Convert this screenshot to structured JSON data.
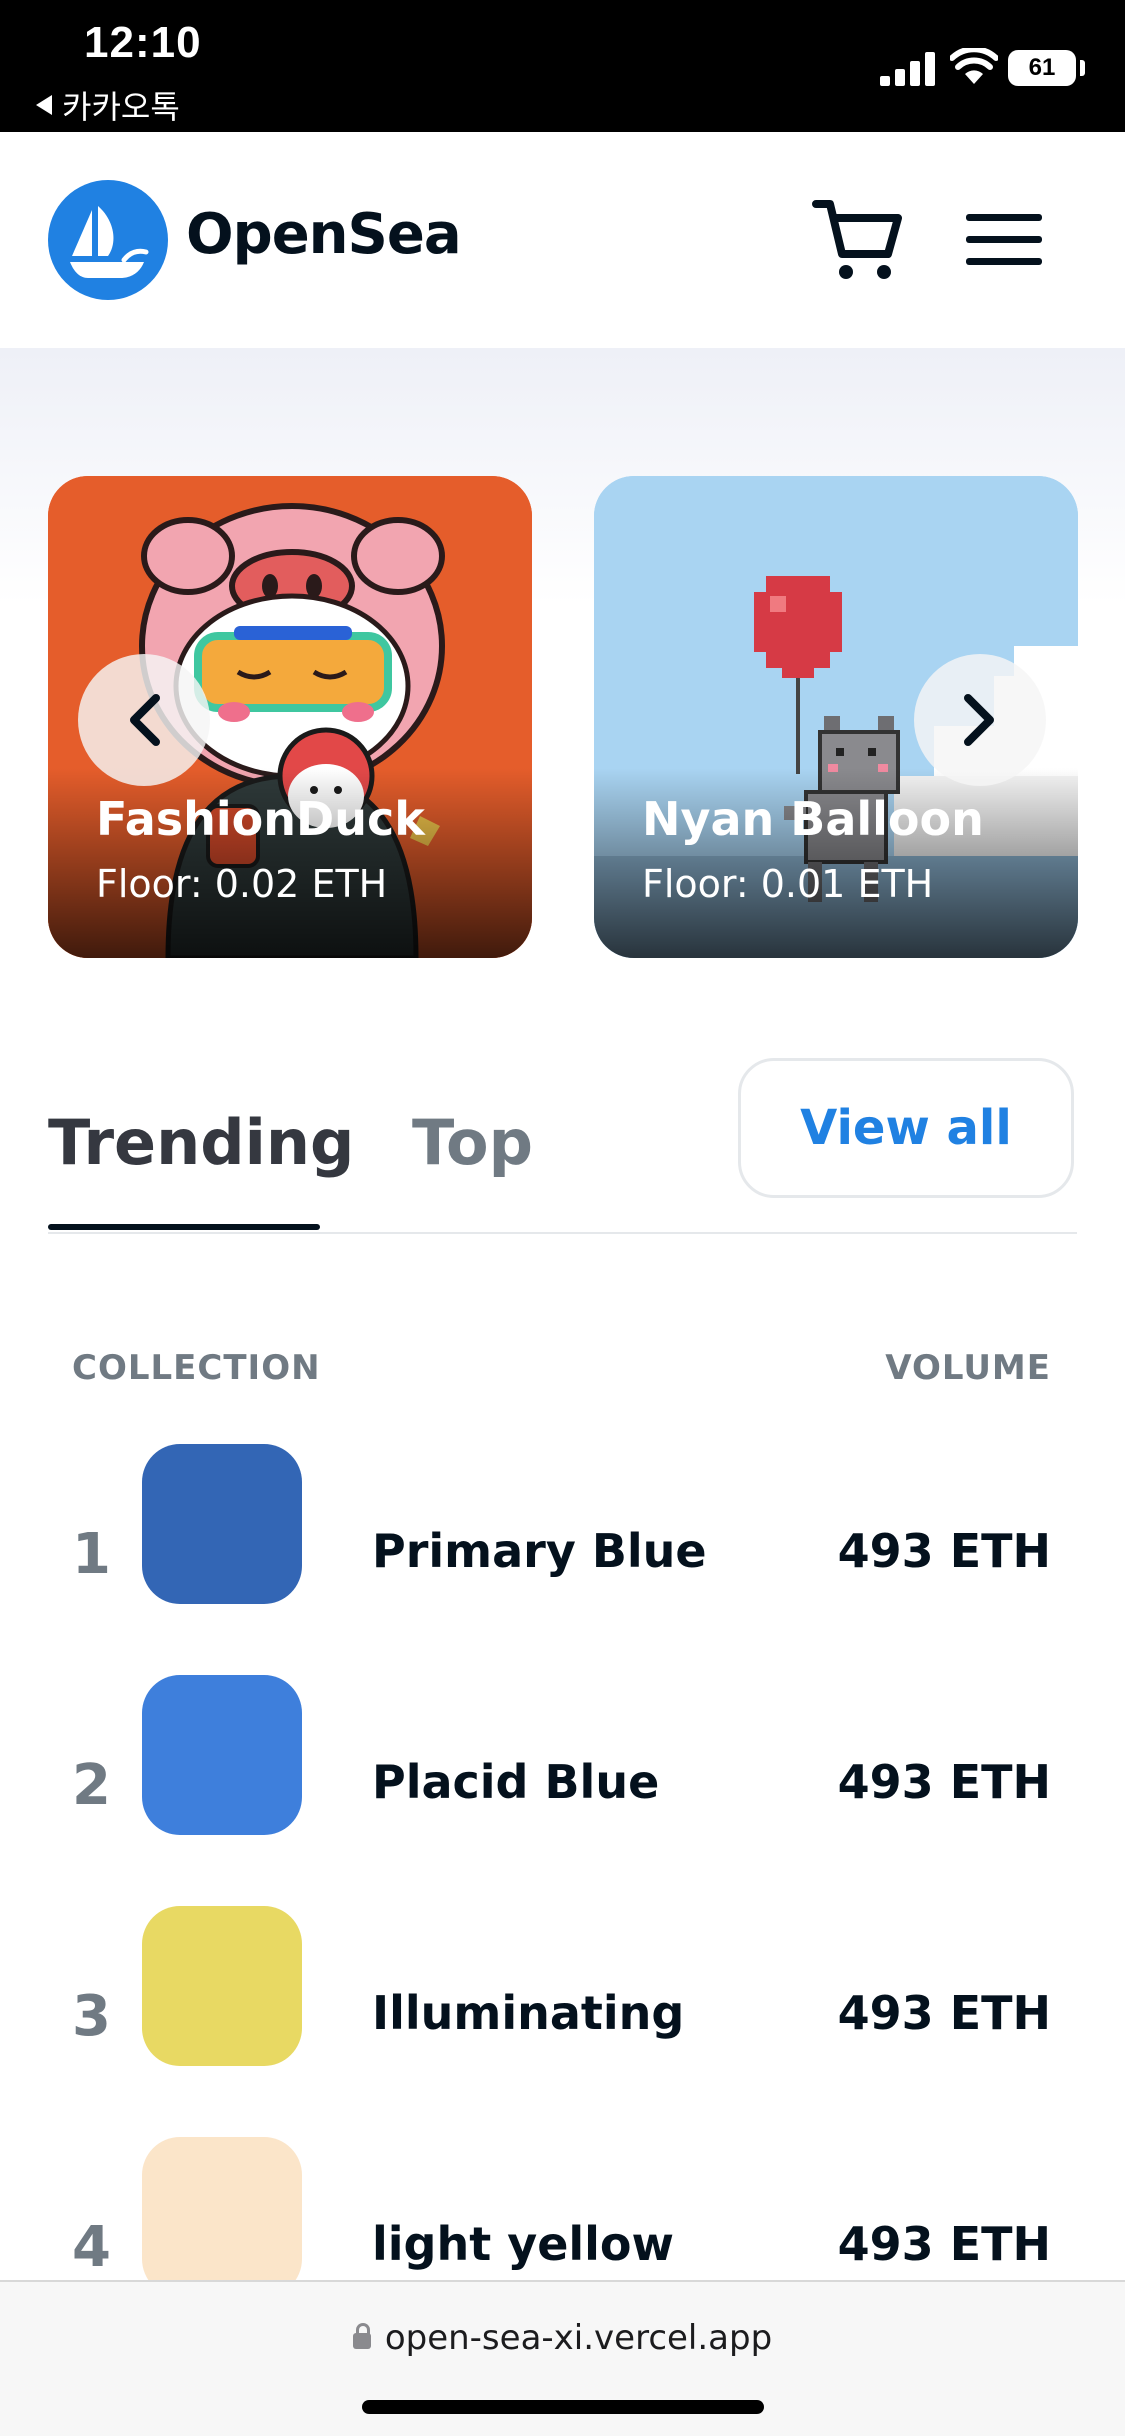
{
  "status_bar": {
    "time": "12:10",
    "back_app": "카카오톡",
    "battery": "61"
  },
  "header": {
    "brand": "OpenSea",
    "icons": [
      "logo-icon",
      "cart-icon",
      "menu-icon"
    ]
  },
  "carousel": {
    "cards": [
      {
        "title": "FashionDuck",
        "floor": "Floor: 0.02 ETH",
        "bg": "#e55d2b"
      },
      {
        "title": "Nyan Balloon",
        "floor": "Floor: 0.01 ETH",
        "bg": "#a9d4f2"
      }
    ]
  },
  "tabs": {
    "items": [
      {
        "label": "Trending",
        "active": true
      },
      {
        "label": "Top",
        "active": false
      }
    ],
    "view_all": "View all"
  },
  "table": {
    "headers": {
      "collection": "COLLECTION",
      "volume": "VOLUME"
    },
    "rows": [
      {
        "rank": "1",
        "name": "Primary Blue",
        "volume": "493 ETH",
        "color": "#3366b5"
      },
      {
        "rank": "2",
        "name": "Placid Blue",
        "volume": "493 ETH",
        "color": "#3e7fdc"
      },
      {
        "rank": "3",
        "name": "Illuminating",
        "volume": "493 ETH",
        "color": "#e8d963"
      },
      {
        "rank": "4",
        "name": "light yellow",
        "volume": "493 ETH",
        "color": "#fbe5c9"
      }
    ]
  },
  "browser": {
    "url": "open-sea-xi.vercel.app"
  },
  "colors": {
    "accent": "#2081e2",
    "text": "#04111d",
    "muted": "#707a83"
  }
}
